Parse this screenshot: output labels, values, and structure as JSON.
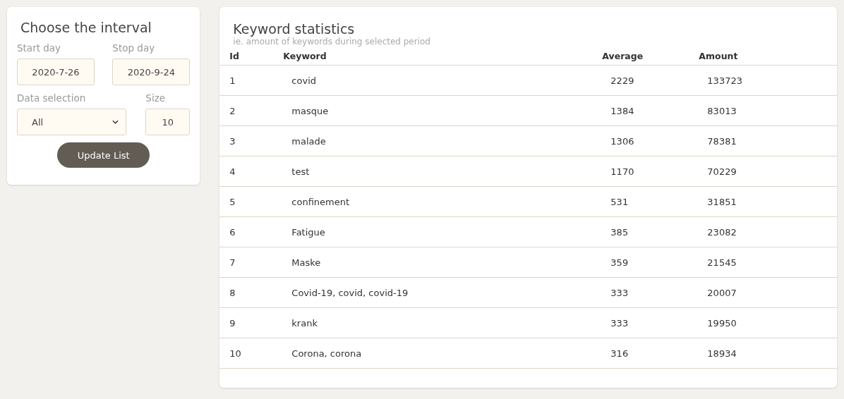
{
  "interval_panel": {
    "title": "Choose the interval",
    "start_day": {
      "label": "Start day",
      "value": "2020-7-26"
    },
    "stop_day": {
      "label": "Stop day",
      "value": "2020-9-24"
    },
    "data_selection": {
      "label": "Data selection",
      "value": "All"
    },
    "size": {
      "label": "Size",
      "value": "10"
    },
    "button": "Update List"
  },
  "stats_panel": {
    "title": "Keyword statistics",
    "subtitle": "ie. amount of keywords during selected period",
    "table": {
      "columns": [
        "Id",
        "Keyword",
        "Average",
        "Amount"
      ],
      "rows": [
        [
          "1",
          "covid",
          "2229",
          "133723"
        ],
        [
          "2",
          "masque",
          "1384",
          "83013"
        ],
        [
          "3",
          "malade",
          "1306",
          "78381"
        ],
        [
          "4",
          "test",
          "1170",
          "70229"
        ],
        [
          "5",
          "confinement",
          "531",
          "31851"
        ],
        [
          "6",
          "Fatigue",
          "385",
          "23082"
        ],
        [
          "7",
          "Maske",
          "359",
          "21545"
        ],
        [
          "8",
          "Covid-19, covid, covid-19",
          "333",
          "20007"
        ],
        [
          "9",
          "krank",
          "333",
          "19950"
        ],
        [
          "10",
          "Corona, corona",
          "316",
          "18934"
        ]
      ]
    }
  }
}
